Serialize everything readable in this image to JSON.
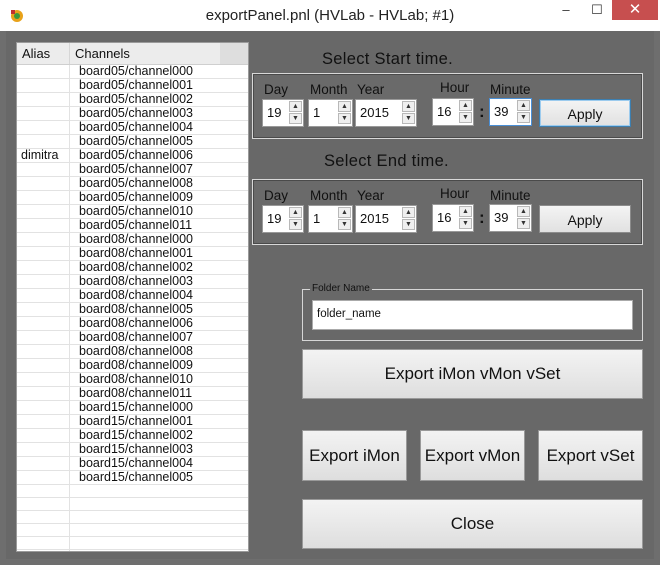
{
  "window": {
    "title": "exportPanel.pnl (HVLab - HVLab; #1)",
    "controls": {
      "minimize": "–",
      "maximize": "☐",
      "close": "✕"
    }
  },
  "table": {
    "headers": {
      "alias": "Alias",
      "channel": "Channels"
    },
    "rows": [
      {
        "alias": "",
        "channel": "board05/channel000"
      },
      {
        "alias": "",
        "channel": "board05/channel001"
      },
      {
        "alias": "",
        "channel": "board05/channel002"
      },
      {
        "alias": "",
        "channel": "board05/channel003"
      },
      {
        "alias": "",
        "channel": "board05/channel004"
      },
      {
        "alias": "",
        "channel": "board05/channel005"
      },
      {
        "alias": "dimitra",
        "channel": "board05/channel006"
      },
      {
        "alias": "",
        "channel": "board05/channel007"
      },
      {
        "alias": "",
        "channel": "board05/channel008"
      },
      {
        "alias": "",
        "channel": "board05/channel009"
      },
      {
        "alias": "",
        "channel": "board05/channel010"
      },
      {
        "alias": "",
        "channel": "board05/channel011"
      },
      {
        "alias": "",
        "channel": "board08/channel000"
      },
      {
        "alias": "",
        "channel": "board08/channel001"
      },
      {
        "alias": "",
        "channel": "board08/channel002"
      },
      {
        "alias": "",
        "channel": "board08/channel003"
      },
      {
        "alias": "",
        "channel": "board08/channel004"
      },
      {
        "alias": "",
        "channel": "board08/channel005"
      },
      {
        "alias": "",
        "channel": "board08/channel006"
      },
      {
        "alias": "",
        "channel": "board08/channel007"
      },
      {
        "alias": "",
        "channel": "board08/channel008"
      },
      {
        "alias": "",
        "channel": "board08/channel009"
      },
      {
        "alias": "",
        "channel": "board08/channel010"
      },
      {
        "alias": "",
        "channel": "board08/channel011"
      },
      {
        "alias": "",
        "channel": "board15/channel000"
      },
      {
        "alias": "",
        "channel": "board15/channel001"
      },
      {
        "alias": "",
        "channel": "board15/channel002"
      },
      {
        "alias": "",
        "channel": "board15/channel003"
      },
      {
        "alias": "",
        "channel": "board15/channel004"
      },
      {
        "alias": "",
        "channel": "board15/channel005"
      }
    ]
  },
  "start": {
    "title": "Select Start time.",
    "labels": {
      "day": "Day",
      "month": "Month",
      "year": "Year",
      "hour": "Hour",
      "minute": "Minute"
    },
    "day": "19",
    "month": "1",
    "year": "2015",
    "hour": "16",
    "minute": "39",
    "separator": ":",
    "apply": "Apply"
  },
  "end": {
    "title": "Select End  time.",
    "labels": {
      "day": "Day",
      "month": "Month",
      "year": "Year",
      "hour": "Hour",
      "minute": "Minute"
    },
    "day": "19",
    "month": "1",
    "year": "2015",
    "hour": "16",
    "minute": "39",
    "separator": ":",
    "apply": "Apply"
  },
  "folder": {
    "legend": "Folder Name",
    "value": "folder_name"
  },
  "buttons": {
    "export_all": "Export iMon  vMon vSet",
    "export_imon": "Export iMon",
    "export_vmon": "Export vMon",
    "export_vset": "Export vSet",
    "close": "Close"
  },
  "icons": {
    "up_arrow": "▲",
    "down_arrow": "▼"
  }
}
